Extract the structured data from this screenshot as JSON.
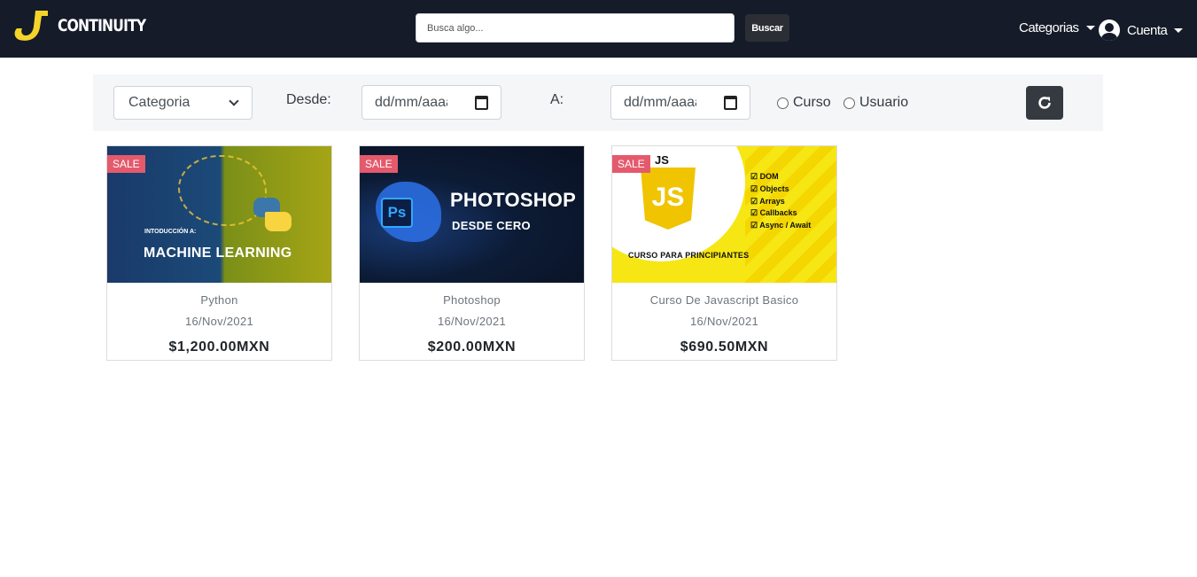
{
  "brand": {
    "name": "CONTINUITY"
  },
  "search": {
    "placeholder": "Busca algo...",
    "button_label": "Buscar"
  },
  "nav": {
    "categories_label": "Categorias",
    "account_label": "Cuenta"
  },
  "filters": {
    "category_select": "Categoria",
    "from_label": "Desde:",
    "from_placeholder": "dd/mm/aaaa",
    "to_label": "A:",
    "to_placeholder": "dd/mm/aaaa",
    "radio_course": "Curso",
    "radio_user": "Usuario"
  },
  "products": [
    {
      "badge": "SALE",
      "title": "Python",
      "date": "16/Nov/2021",
      "price": "$1,200.00MXN",
      "image_text": {
        "intro": "INTODUCCIÓN A:",
        "headline": "MACHINE LEARNING"
      }
    },
    {
      "badge": "SALE",
      "title": "Photoshop",
      "date": "16/Nov/2021",
      "price": "$200.00MXN",
      "image_text": {
        "icon": "Ps",
        "headline": "PHOTOSHOP",
        "subtitle": "DESDE CERO"
      }
    },
    {
      "badge": "SALE",
      "title": "Curso De Javascript Basico",
      "date": "16/Nov/2021",
      "price": "$690.50MXN",
      "image_text": {
        "tag": "JS",
        "logo": "JS",
        "topics": [
          "DOM",
          "Objects",
          "Arrays",
          "Callbacks",
          "Async / Await"
        ],
        "footer": "CURSO PARA PRINCIPIANTES"
      }
    }
  ],
  "colors": {
    "navbar": "#151b28",
    "brand_yellow": "#f4d42a",
    "sale_badge": "#e45a6c",
    "filter_bg": "#f5f6f8",
    "button_dark": "#343a40"
  }
}
